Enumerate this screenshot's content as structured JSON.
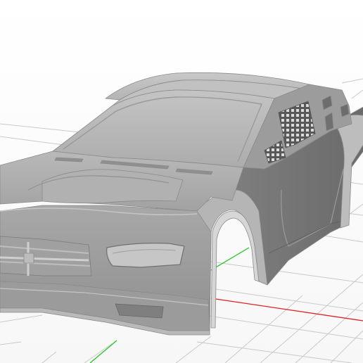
{
  "scene": {
    "subject": "car-body-shell-3d-model",
    "background_color": "#ffffff",
    "grid_color": "#c9c9c9",
    "model_color": "#a9a9a9"
  },
  "axes": {
    "x_color": "#e02020",
    "y_color": "#22c422"
  }
}
